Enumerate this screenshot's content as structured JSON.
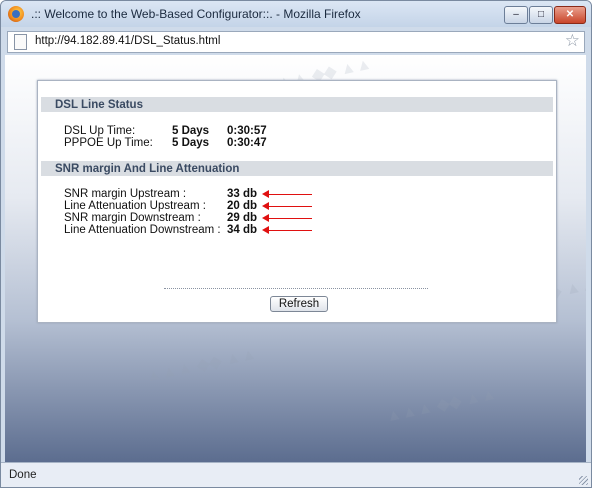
{
  "window": {
    "title": ".:: Welcome to the Web-Based Configurator::. - Mozilla Firefox",
    "minimize_glyph": "–",
    "maximize_glyph": "□",
    "close_glyph": "✕"
  },
  "address_bar": {
    "url": "http://94.182.89.41/DSL_Status.html"
  },
  "dsl_line_status": {
    "title": "DSL Line Status",
    "rows": [
      {
        "label": "DSL Up Time:",
        "days": "5 Days",
        "time": "0:30:57"
      },
      {
        "label": "PPPOE Up Time:",
        "days": "5 Days",
        "time": "0:30:47"
      }
    ]
  },
  "snr_section": {
    "title": "SNR margin And Line Attenuation",
    "rows": [
      {
        "label": "SNR margin Upstream :",
        "value": "33 db"
      },
      {
        "label": "Line Attenuation Upstream :",
        "value": "20 db"
      },
      {
        "label": "SNR margin Downstream :",
        "value": "29 db"
      },
      {
        "label": "Line Attenuation Downstream :",
        "value": "34 db"
      }
    ]
  },
  "refresh_label": "Refresh",
  "status_bar": {
    "text": "Done"
  },
  "colors": {
    "arrow": "#e01010",
    "section_header": "#d9dde2",
    "section_title": "#3a4a62"
  }
}
